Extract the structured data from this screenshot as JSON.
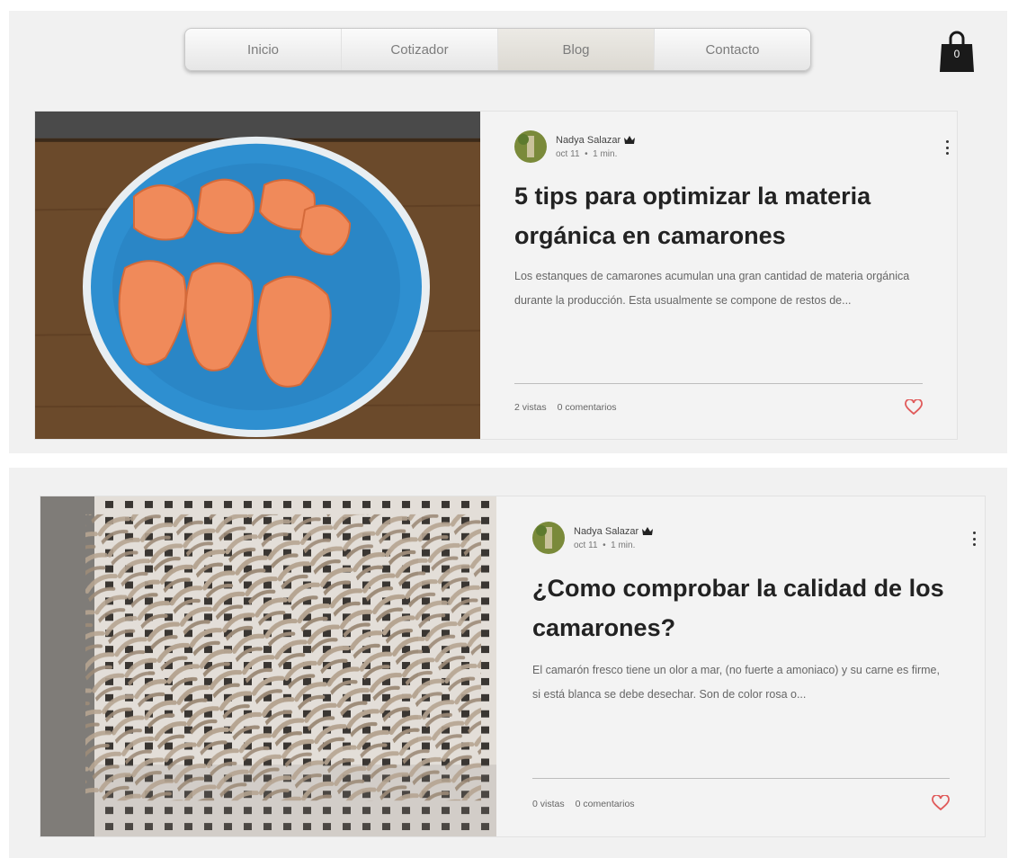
{
  "nav": {
    "items": [
      {
        "label": "Inicio",
        "active": false
      },
      {
        "label": "Cotizador",
        "active": false
      },
      {
        "label": "Blog",
        "active": true
      },
      {
        "label": "Contacto",
        "active": false
      }
    ]
  },
  "cart": {
    "count": "0",
    "icon": "shopping-bag-icon"
  },
  "colors": {
    "heart": "#e05a5a",
    "nav_active": "#dcd9d2",
    "text": "#222222"
  },
  "posts": [
    {
      "author": "Nadya Salazar",
      "date": "oct 11",
      "separator": "•",
      "read_time": "1 min.",
      "title": "5 tips para optimizar la materia orgánica en camarones",
      "excerpt": "Los estanques de camarones acumulan una gran cantidad de materia orgánica durante la producción. Esta usualmente se compone de restos de...",
      "views": "2 vistas",
      "comments": "0 comentarios"
    },
    {
      "author": "Nadya Salazar",
      "date": "oct 11",
      "separator": "•",
      "read_time": "1 min.",
      "title": "¿Como comprobar la calidad de los camarones?",
      "excerpt": "El camarón fresco tiene un olor a mar, (no fuerte a amoniaco) y su carne es firme, si está blanca se debe desechar. Son de color rosa o...",
      "views": "0 vistas",
      "comments": "0 comentarios"
    }
  ]
}
